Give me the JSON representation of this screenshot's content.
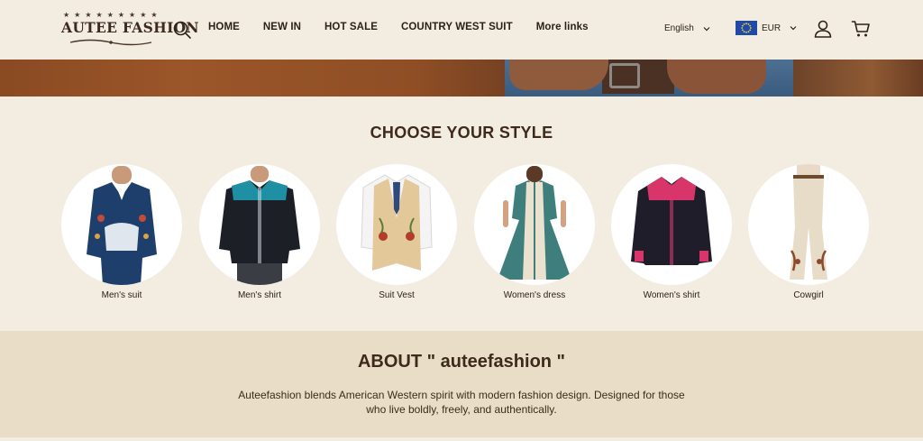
{
  "logo": {
    "text": "AUTEE FASHION",
    "stars": "★★★★★★★★★"
  },
  "nav": {
    "items": [
      "HOME",
      "NEW IN",
      "HOT SALE",
      "COUNTRY WEST SUIT",
      "More links"
    ]
  },
  "header": {
    "language": "English",
    "currency": "EUR"
  },
  "style_section": {
    "title": "CHOOSE YOUR STYLE",
    "categories": [
      {
        "label": "Men's suit"
      },
      {
        "label": "Men's shirt"
      },
      {
        "label": "Suit Vest"
      },
      {
        "label": "Women's dress"
      },
      {
        "label": "Women's shirt"
      },
      {
        "label": "Cowgirl"
      }
    ]
  },
  "about": {
    "title": "ABOUT \" auteefashion \"",
    "text": "Auteefashion blends American Western spirit with modern fashion design. Designed for those who live boldly, freely, and authentically."
  },
  "colors": {
    "background": "#f2ece1",
    "about_background": "#e9ddc8",
    "text": "#3a2a1c"
  }
}
